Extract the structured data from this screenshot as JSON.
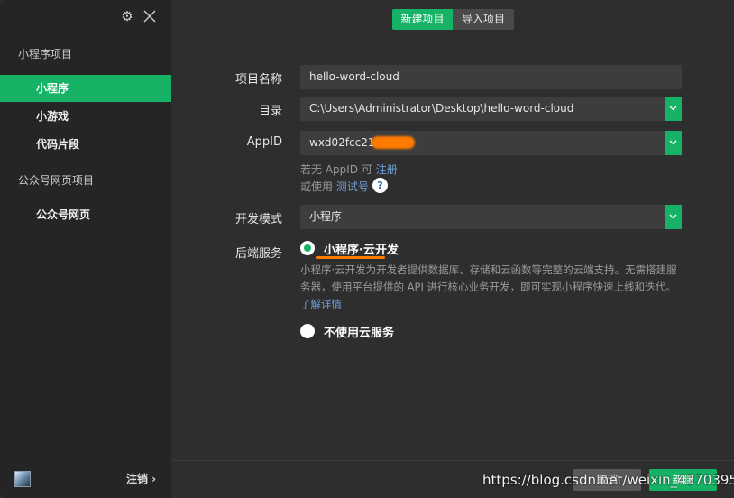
{
  "sidebar": {
    "section_mini": "小程序项目",
    "items_mini": [
      {
        "label": "小程序",
        "active": true
      },
      {
        "label": "小游戏",
        "active": false
      },
      {
        "label": "代码片段",
        "active": false
      }
    ],
    "section_oa": "公众号网页项目",
    "items_oa": [
      {
        "label": "公众号网页",
        "active": false
      }
    ],
    "logout_label": "注销 ›"
  },
  "tabs": {
    "new_label": "新建项目",
    "import_label": "导入项目"
  },
  "form": {
    "name_label": "项目名称",
    "name_value": "hello-word-cloud",
    "dir_label": "目录",
    "dir_value": "C:\\Users\\Administrator\\Desktop\\hello-word-cloud",
    "appid_label": "AppID",
    "appid_value": "wxd02fcc21e",
    "no_appid_text": "若无 AppID 可",
    "register_link": "注册",
    "or_use_text": "或使用",
    "test_link": "测试号",
    "help_symbol": "?",
    "mode_label": "开发模式",
    "mode_value": "小程序",
    "backend_label": "后端服务",
    "cloud_option_label": "小程序·云开发",
    "cloud_desc": "小程序·云开发为开发者提供数据库、存储和云函数等完整的云端支持。无需搭建服务器，使用平台提供的 API 进行核心业务开发，即可实现小程序快速上线和迭代。",
    "learn_more_link": "了解详情",
    "no_cloud_option_label": "不使用云服务"
  },
  "footer": {
    "cancel_label": "取消",
    "create_label": "新建"
  },
  "watermark": "https://blog.csdn.net/weixin_43703951",
  "colors": {
    "accent": "#16b266",
    "background": "#2e2e2e",
    "sidebar": "#252526",
    "input": "#3d3d3d",
    "link": "#6f9ed8",
    "highlight": "#ff7a00"
  }
}
